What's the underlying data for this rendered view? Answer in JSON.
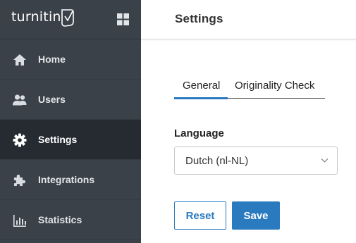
{
  "brand": {
    "logo_text": "turnitin"
  },
  "sidebar": {
    "items": [
      {
        "label": "Home",
        "icon": "home-icon"
      },
      {
        "label": "Users",
        "icon": "users-icon"
      },
      {
        "label": "Settings",
        "icon": "gear-icon",
        "active": true
      },
      {
        "label": "Integrations",
        "icon": "puzzle-icon"
      },
      {
        "label": "Statistics",
        "icon": "bar-chart-icon"
      }
    ]
  },
  "header": {
    "title": "Settings"
  },
  "tabs": [
    {
      "label": "General",
      "active": true
    },
    {
      "label": "Originality Check",
      "active": false
    }
  ],
  "form": {
    "language_label": "Language",
    "language_value": "Dutch (nl-NL)"
  },
  "actions": {
    "reset_label": "Reset",
    "save_label": "Save"
  },
  "colors": {
    "sidebar": "#3a4149",
    "sidebar_active": "#262b31",
    "accent": "#2a7abf"
  }
}
